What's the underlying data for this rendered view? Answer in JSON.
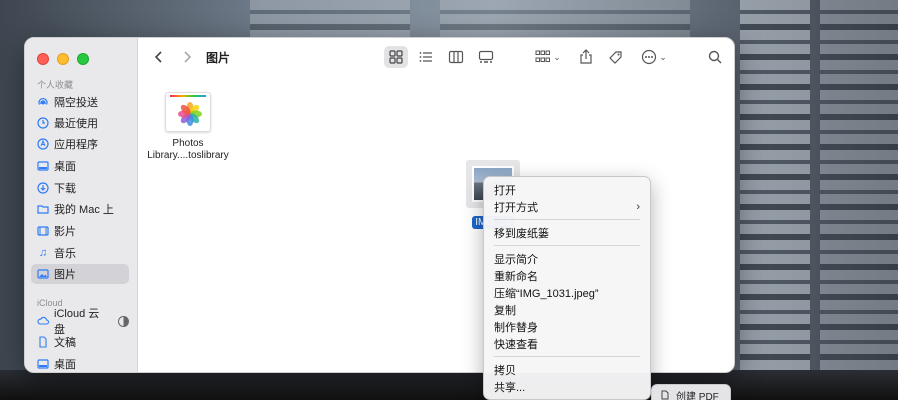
{
  "window": {
    "title": "图片"
  },
  "sidebar": {
    "favorites_title": "个人收藏",
    "icloud_title": "iCloud",
    "favorites": [
      {
        "label": "隔空投送"
      },
      {
        "label": "最近使用"
      },
      {
        "label": "应用程序"
      },
      {
        "label": "桌面"
      },
      {
        "label": "下载"
      },
      {
        "label": "我的 Mac 上"
      },
      {
        "label": "影片"
      },
      {
        "label": "音乐"
      },
      {
        "label": "图片"
      }
    ],
    "icloud": [
      {
        "label": "iCloud 云盘"
      },
      {
        "label": "文稿"
      },
      {
        "label": "桌面"
      }
    ]
  },
  "files": [
    {
      "label_line1": "Photos",
      "label_line2": "Library....toslibrary"
    },
    {
      "label": "IMG_10"
    }
  ],
  "context_menu": {
    "items": [
      {
        "label": "打开"
      },
      {
        "label": "打开方式"
      },
      {
        "label": "移到废纸篓"
      },
      {
        "label": "显示简介"
      },
      {
        "label": "重新命名"
      },
      {
        "label": "压缩“IMG_1031.jpeg”"
      },
      {
        "label": "复制"
      },
      {
        "label": "制作替身"
      },
      {
        "label": "快速查看"
      },
      {
        "label": "拷贝"
      },
      {
        "label": "共享..."
      }
    ],
    "submenu_peek": "创建 PDF"
  },
  "colors": {
    "accent": "#2f7cf6",
    "selection": "#1e65c8"
  }
}
